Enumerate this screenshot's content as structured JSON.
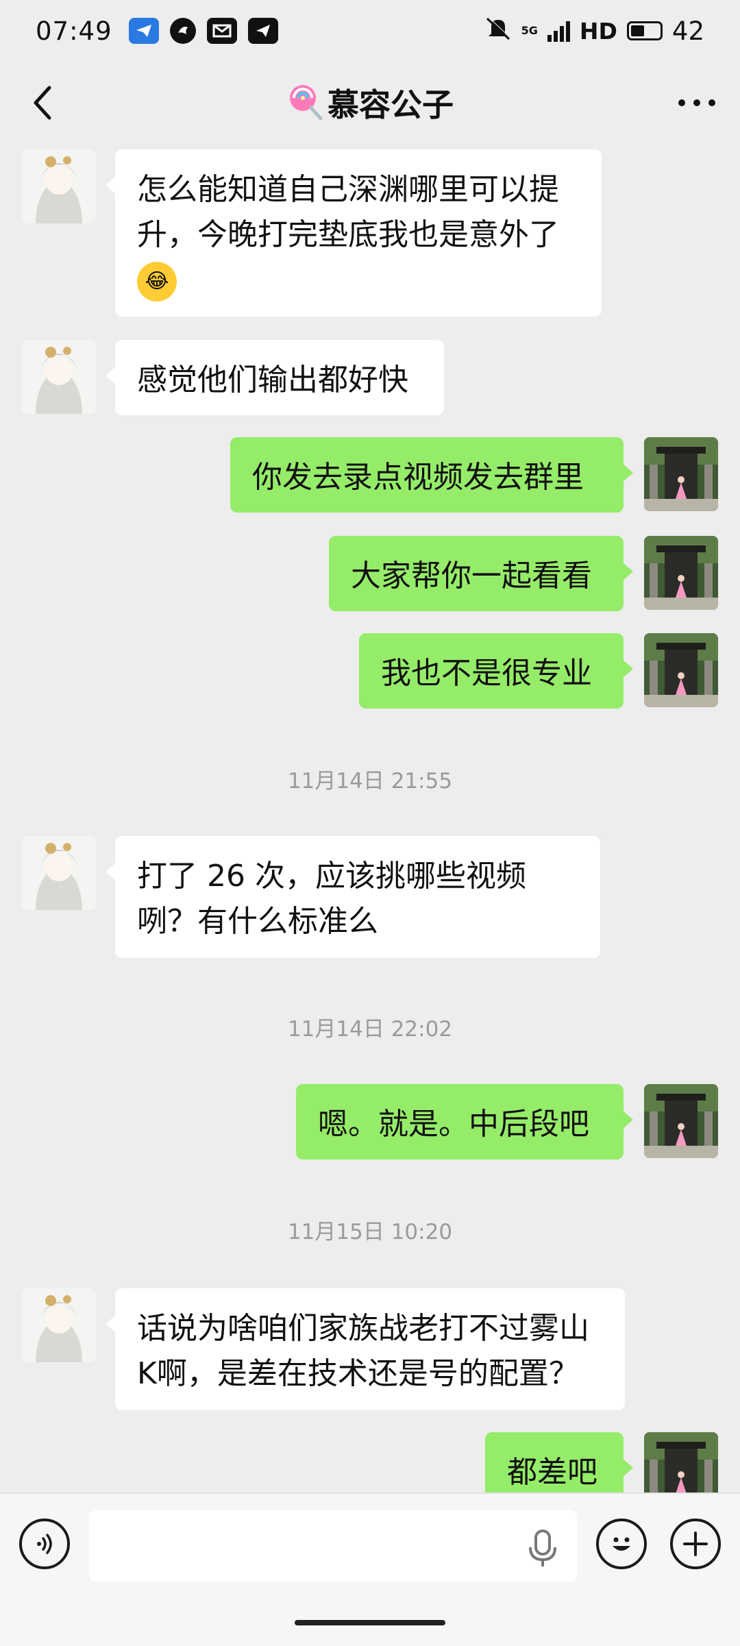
{
  "status_bar": {
    "time": "07:49",
    "network": "5G",
    "hd": "HD",
    "battery": "42",
    "icons": [
      "telegram-icon",
      "bird-icon",
      "mail-icon",
      "send-icon"
    ]
  },
  "header": {
    "title": "慕容公子",
    "title_prefix_icon": "lollipop-icon",
    "back_icon": "chevron-left-icon",
    "more_icon": "more-dots-icon"
  },
  "messages": [
    {
      "side": "in",
      "text": "怎么能知道自己深渊哪里可以提升，今晚打完垫底我也是意外了",
      "emoji": "tears-of-joy-emoji"
    },
    {
      "side": "in",
      "text": "感觉他们输出都好快"
    },
    {
      "side": "out",
      "text": "你发去录点视频发去群里"
    },
    {
      "side": "out",
      "text": "大家帮你一起看看"
    },
    {
      "side": "out",
      "text": "我也不是很专业"
    },
    {
      "type": "time",
      "text": "11月14日 21:55"
    },
    {
      "side": "in",
      "text": "打了 26 次，应该挑哪些视频咧？有什么标准么"
    },
    {
      "type": "time",
      "text": "11月14日 22:02"
    },
    {
      "side": "out",
      "text": "嗯。就是。中后段吧"
    },
    {
      "type": "time",
      "text": "11月15日 10:20"
    },
    {
      "side": "in",
      "text": "话说为啥咱们家族战老打不过雾山K啊，是差在技术还是号的配置？"
    },
    {
      "side": "out",
      "text": "都差吧"
    }
  ],
  "input_bar": {
    "placeholder": "",
    "voice_icon": "voice-icon",
    "mic_icon": "microphone-icon",
    "emoji_icon": "smiley-icon",
    "plus_icon": "plus-icon"
  },
  "colors": {
    "background": "#ededed",
    "incoming_bubble": "#ffffff",
    "outgoing_bubble": "#95ec69",
    "timestamp_text": "#9a9a9a"
  }
}
